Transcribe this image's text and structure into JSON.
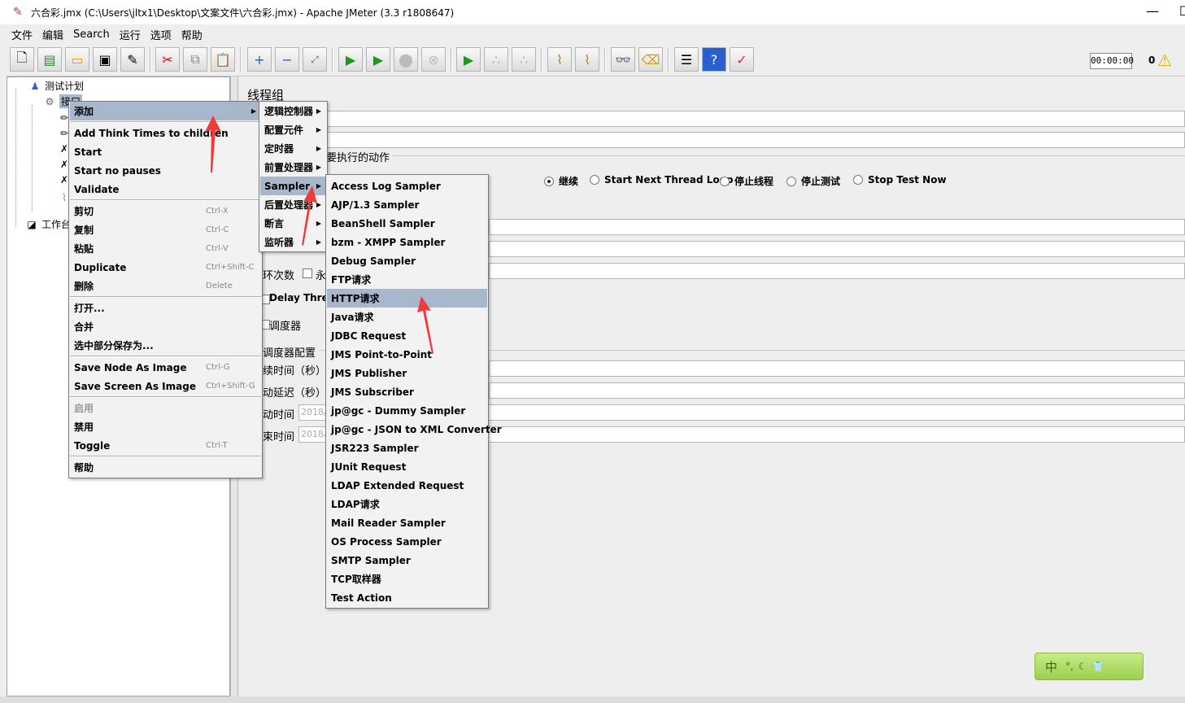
{
  "window": {
    "title": "六合彩.jmx (C:\\Users\\jltx1\\Desktop\\文案文件\\六合彩.jmx) - Apache JMeter (3.3 r1808647)",
    "minimize": "—",
    "maximize": "☐"
  },
  "menubar": [
    "文件",
    "编辑",
    "Search",
    "运行",
    "选项",
    "帮助"
  ],
  "toolbar": {
    "timer": "00:00:00",
    "error_count": "0",
    "icons": [
      "new-icon",
      "templates-icon",
      "open-icon",
      "save-icon",
      "save-as-icon",
      "cut-icon",
      "copy-icon",
      "paste-icon",
      "expand-icon",
      "collapse-icon",
      "toggle-icon",
      "start-icon",
      "start-no-pauses-icon",
      "stop-icon",
      "shutdown-icon",
      "remote-start-icon",
      "remote-stop-icon",
      "remote-shutdown-icon",
      "clear-icon",
      "clear-all-icon",
      "search-icon",
      "reset-search-icon",
      "function-helper-icon",
      "help-icon",
      "log-viewer-icon"
    ]
  },
  "tree": {
    "root": "测试计划",
    "thread_group": "接口",
    "workbench": "工作台"
  },
  "right_panel": {
    "title": "线程组",
    "action_label": "要执行的动作",
    "radio_options": [
      "继续",
      "Start Next Thread Loop",
      "停止线程",
      "停止测试",
      "Stop Test Now"
    ],
    "loop_label": "环次数",
    "forever_label": "永",
    "delay_label": "Delay Threa",
    "scheduler_label": "调度器",
    "scheduler_config_label": "调度器配置",
    "duration_label": "续时间（秒）",
    "startup_delay_label": "动延迟（秒）",
    "start_time_label": "动时间",
    "end_time_label": "束时间",
    "start_time_value": "2018/",
    "end_time_value": "2018/"
  },
  "context_menu": {
    "items": [
      {
        "label": "添加",
        "accel": "",
        "submenu": true,
        "selected": true
      },
      {
        "label": "Add Think Times to children",
        "accel": ""
      },
      {
        "label": "Start",
        "accel": ""
      },
      {
        "label": "Start no pauses",
        "accel": ""
      },
      {
        "label": "Validate",
        "accel": ""
      },
      {
        "label": "剪切",
        "accel": "Ctrl-X"
      },
      {
        "label": "复制",
        "accel": "Ctrl-C"
      },
      {
        "label": "粘贴",
        "accel": "Ctrl-V"
      },
      {
        "label": "Duplicate",
        "accel": "Ctrl+Shift-C"
      },
      {
        "label": "删除",
        "accel": "Delete"
      },
      {
        "label": "打开...",
        "accel": ""
      },
      {
        "label": "合并",
        "accel": ""
      },
      {
        "label": "选中部分保存为...",
        "accel": ""
      },
      {
        "label": "Save Node As Image",
        "accel": "Ctrl-G"
      },
      {
        "label": "Save Screen As Image",
        "accel": "Ctrl+Shift-G"
      },
      {
        "label": "启用",
        "accel": "",
        "disabled": true
      },
      {
        "label": "禁用",
        "accel": ""
      },
      {
        "label": "Toggle",
        "accel": "Ctrl-T"
      },
      {
        "label": "帮助",
        "accel": ""
      }
    ]
  },
  "add_submenu": {
    "items": [
      "逻辑控制器",
      "配置元件",
      "定时器",
      "前置处理器",
      "Sampler",
      "后置处理器",
      "断言",
      "监听器"
    ],
    "selected": "Sampler"
  },
  "sampler_submenu": {
    "items": [
      "Access Log Sampler",
      "AJP/1.3 Sampler",
      "BeanShell Sampler",
      "bzm - XMPP Sampler",
      "Debug Sampler",
      "FTP请求",
      "HTTP请求",
      "Java请求",
      "JDBC Request",
      "JMS Point-to-Point",
      "JMS Publisher",
      "JMS Subscriber",
      "jp@gc - Dummy Sampler",
      "jp@gc - JSON to XML Converter",
      "JSR223 Sampler",
      "JUnit Request",
      "LDAP Extended Request",
      "LDAP请求",
      "Mail Reader Sampler",
      "OS Process Sampler",
      "SMTP Sampler",
      "TCP取样器",
      "Test Action"
    ],
    "selected": "HTTP请求"
  },
  "ime": {
    "label": "中"
  },
  "colors": {
    "selection": "#a8b8cc",
    "arrow": "#ee3b3b",
    "menu_bg": "#f2f2f2"
  }
}
